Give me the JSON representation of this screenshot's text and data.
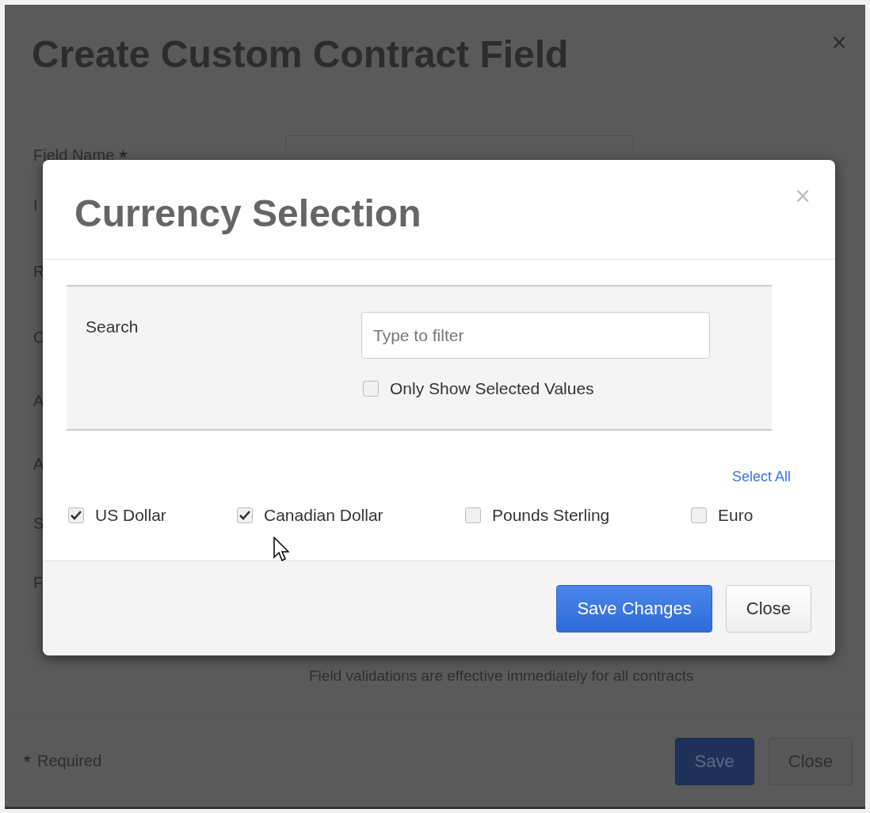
{
  "background_dialog": {
    "title": "Create Custom Contract Field",
    "close": "×",
    "field_name": {
      "label": "Field Name",
      "required_mark": "★"
    },
    "cut_labels": [
      "I",
      "R",
      "C",
      "A",
      "A",
      "S",
      "F"
    ],
    "hint": "Field validations are effective immediately for all contracts",
    "footer": {
      "required_mark": "★",
      "required_note": "Required",
      "buttons": [
        {
          "label": "Save",
          "kind": "primary"
        },
        {
          "label": "Close",
          "kind": "default"
        }
      ]
    }
  },
  "dialog": {
    "title": "Currency Selection",
    "close": "×",
    "search": {
      "label": "Search",
      "placeholder": "Type to filter"
    },
    "only_selected": {
      "label": "Only Show Selected Values",
      "checked": false
    },
    "select_all": "Select All",
    "currencies": [
      {
        "label": "US Dollar",
        "checked": true
      },
      {
        "label": "Canadian Dollar",
        "checked": true
      },
      {
        "label": "Pounds Sterling",
        "checked": false
      },
      {
        "label": "Euro",
        "checked": false
      }
    ],
    "buttons": [
      {
        "label": "Save Changes",
        "kind": "primary"
      },
      {
        "label": "Close",
        "kind": "default"
      }
    ]
  }
}
